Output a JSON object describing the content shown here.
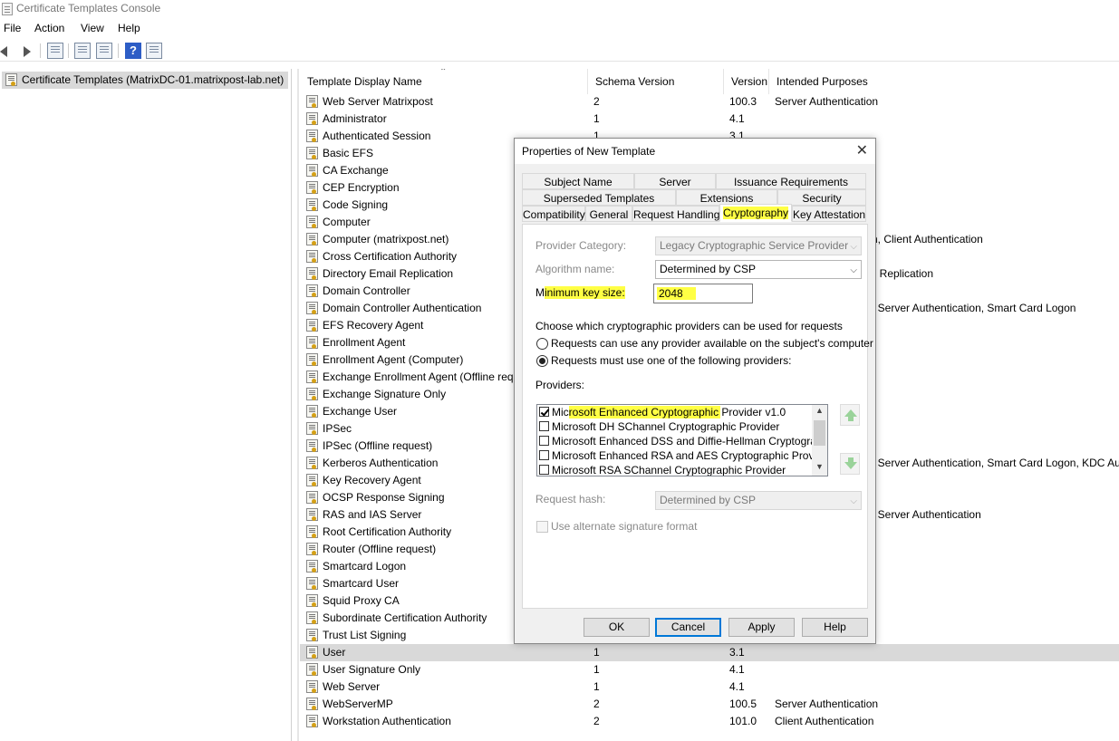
{
  "window": {
    "title": "Certificate Templates Console"
  },
  "menu": [
    "File",
    "Action",
    "View",
    "Help"
  ],
  "tree": {
    "root_label": "Certificate Templates (MatrixDC-01.matrixpost-lab.net)"
  },
  "list": {
    "columns": [
      "Template Display Name",
      "Schema Version",
      "Version",
      "Intended Purposes"
    ],
    "rows": [
      {
        "name": "Web Server Matrixpost",
        "schema": "2",
        "version": "100.3",
        "purposes": "Server Authentication"
      },
      {
        "name": "Administrator",
        "schema": "1",
        "version": "4.1",
        "purposes": ""
      },
      {
        "name": "Authenticated Session",
        "schema": "1",
        "version": "3.1",
        "purposes": ""
      },
      {
        "name": "Basic EFS",
        "schema": "",
        "version": "",
        "purposes": ""
      },
      {
        "name": "CA Exchange",
        "schema": "",
        "version": "",
        "purposes": ""
      },
      {
        "name": "CEP Encryption",
        "schema": "",
        "version": "",
        "purposes": ""
      },
      {
        "name": "Code Signing",
        "schema": "",
        "version": "",
        "purposes": ""
      },
      {
        "name": "Computer",
        "schema": "",
        "version": "",
        "purposes": ""
      },
      {
        "name": "Computer (matrixpost.net)",
        "schema": "",
        "version": "",
        "purposes": ""
      },
      {
        "name": "Cross Certification Authority",
        "schema": "",
        "version": "",
        "purposes": ""
      },
      {
        "name": "Directory Email Replication",
        "schema": "",
        "version": "",
        "purposes": ""
      },
      {
        "name": "Domain Controller",
        "schema": "",
        "version": "",
        "purposes": ""
      },
      {
        "name": "Domain Controller Authentication",
        "schema": "",
        "version": "",
        "purposes": ""
      },
      {
        "name": "EFS Recovery Agent",
        "schema": "",
        "version": "",
        "purposes": ""
      },
      {
        "name": "Enrollment Agent",
        "schema": "",
        "version": "",
        "purposes": ""
      },
      {
        "name": "Enrollment Agent (Computer)",
        "schema": "",
        "version": "",
        "purposes": ""
      },
      {
        "name": "Exchange Enrollment Agent (Offline req",
        "schema": "",
        "version": "",
        "purposes": ""
      },
      {
        "name": "Exchange Signature Only",
        "schema": "",
        "version": "",
        "purposes": ""
      },
      {
        "name": "Exchange User",
        "schema": "",
        "version": "",
        "purposes": ""
      },
      {
        "name": "IPSec",
        "schema": "",
        "version": "",
        "purposes": ""
      },
      {
        "name": "IPSec (Offline request)",
        "schema": "",
        "version": "",
        "purposes": ""
      },
      {
        "name": "Kerberos Authentication",
        "schema": "",
        "version": "",
        "purposes": ""
      },
      {
        "name": "Key Recovery Agent",
        "schema": "",
        "version": "",
        "purposes": ""
      },
      {
        "name": "OCSP Response Signing",
        "schema": "",
        "version": "",
        "purposes": ""
      },
      {
        "name": "RAS and IAS Server",
        "schema": "",
        "version": "",
        "purposes": ""
      },
      {
        "name": "Root Certification Authority",
        "schema": "",
        "version": "",
        "purposes": ""
      },
      {
        "name": "Router (Offline request)",
        "schema": "",
        "version": "",
        "purposes": ""
      },
      {
        "name": "Smartcard Logon",
        "schema": "",
        "version": "",
        "purposes": ""
      },
      {
        "name": "Smartcard User",
        "schema": "",
        "version": "",
        "purposes": ""
      },
      {
        "name": "Squid Proxy CA",
        "schema": "",
        "version": "",
        "purposes": ""
      },
      {
        "name": "Subordinate Certification Authority",
        "schema": "",
        "version": "",
        "purposes": ""
      },
      {
        "name": "Trust List Signing",
        "schema": "",
        "version": "",
        "purposes": ""
      },
      {
        "name": "User",
        "schema": "1",
        "version": "3.1",
        "purposes": "",
        "selected": true
      },
      {
        "name": "User Signature Only",
        "schema": "1",
        "version": "4.1",
        "purposes": ""
      },
      {
        "name": "Web Server",
        "schema": "1",
        "version": "4.1",
        "purposes": ""
      },
      {
        "name": "WebServerMP",
        "schema": "2",
        "version": "100.5",
        "purposes": "Server Authentication"
      },
      {
        "name": "Workstation Authentication",
        "schema": "2",
        "version": "101.0",
        "purposes": "Client Authentication"
      }
    ],
    "partial_purposes": [
      {
        "row": 8,
        "text": "n, Client Authentication"
      },
      {
        "row": 10,
        "text": "il Replication"
      },
      {
        "row": 12,
        "text": ", Server Authentication, Smart Card Logon"
      },
      {
        "row": 21,
        "text": ", Server Authentication, Smart Card Logon, KDC Au"
      },
      {
        "row": 24,
        "text": ", Server Authentication"
      }
    ]
  },
  "dialog": {
    "title": "Properties of New Template",
    "close": "✕",
    "tabs_row1": [
      "Subject Name",
      "Server",
      "Issuance Requirements"
    ],
    "tabs_row2": [
      "Superseded Templates",
      "Extensions",
      "Security"
    ],
    "tabs_row3": [
      "Compatibility",
      "General",
      "Request Handling",
      "Cryptography",
      "Key Attestation"
    ],
    "active_tab": "Cryptography",
    "provider_category_label": "Provider Category:",
    "provider_category_value": "Legacy Cryptographic Service Provider",
    "algorithm_label": "Algorithm name:",
    "algorithm_value": "Determined by CSP",
    "min_key_label": "Minimum key size:",
    "min_key_value": "2048",
    "choose_text": "Choose which cryptographic providers can be used for requests",
    "radio_any": "Requests can use any provider available on the subject's computer",
    "radio_must": "Requests must use one of the following providers:",
    "providers_label": "Providers:",
    "providers": [
      {
        "name": "Microsoft Enhanced Cryptographic Provider v1.0",
        "checked": true
      },
      {
        "name": "Microsoft DH SChannel Cryptographic Provider",
        "checked": false
      },
      {
        "name": "Microsoft Enhanced DSS and Diffie-Hellman Cryptographic Pr",
        "checked": false
      },
      {
        "name": "Microsoft Enhanced RSA and AES Cryptographic Provider",
        "checked": false
      },
      {
        "name": "Microsoft RSA SChannel Cryptographic Provider",
        "checked": false
      }
    ],
    "request_hash_label": "Request hash:",
    "request_hash_value": "Determined by CSP",
    "alt_sig_label": "Use alternate signature format",
    "buttons": {
      "ok": "OK",
      "cancel": "Cancel",
      "apply": "Apply",
      "help": "Help"
    },
    "highlight_color": "#ffff44"
  }
}
